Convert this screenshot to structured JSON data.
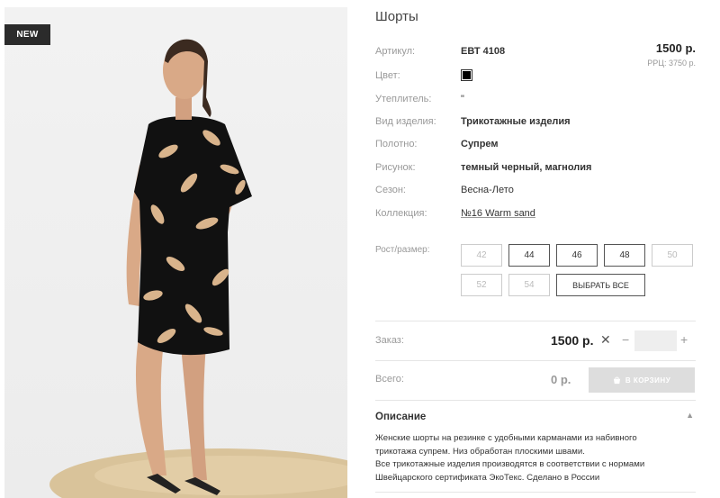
{
  "badge": "NEW",
  "product": {
    "title": "Шорты",
    "price": "1500 р.",
    "rrp": "РРЦ: 3750 р.",
    "attrs": [
      {
        "label": "Артикул:",
        "value": "ЕВТ 4108"
      },
      {
        "label": "Цвет:",
        "value": ""
      },
      {
        "label": "Утеплитель:",
        "value": "\""
      },
      {
        "label": "Вид изделия:",
        "value": "Трикотажные изделия"
      },
      {
        "label": "Полотно:",
        "value": "Супрем"
      },
      {
        "label": "Рисунок:",
        "value": "темный черный, магнолия"
      },
      {
        "label": "Сезон:",
        "value": "Весна-Лето"
      },
      {
        "label": "Коллекция:",
        "value": "№16 Warm sand"
      }
    ],
    "color_swatch": "#000000"
  },
  "sizes": {
    "label": "Рост/размер:",
    "items": [
      {
        "label": "42",
        "available": false
      },
      {
        "label": "44",
        "available": true
      },
      {
        "label": "46",
        "available": true
      },
      {
        "label": "48",
        "available": true
      },
      {
        "label": "50",
        "available": false
      },
      {
        "label": "52",
        "available": false
      },
      {
        "label": "54",
        "available": false
      }
    ],
    "select_all": "ВЫБРАТЬ ВСЕ"
  },
  "order": {
    "label": "Заказ:",
    "price": "1500 р.",
    "times": "✕",
    "minus": "−",
    "plus": "+",
    "qty_value": ""
  },
  "total": {
    "label": "Всего:",
    "value": "0 р.",
    "cart_button": "В КОРЗИНУ"
  },
  "description": {
    "title": "Описание",
    "lines": [
      "Женские шорты на резинке с удобными карманами из набивного",
      "трикотажа супрем. Низ обработан плоскими швами.",
      "Все трикотажные изделия производятся в соответствии с нормами",
      "Швейцарского сертификата ЭкоТекс. Сделано в России"
    ]
  }
}
